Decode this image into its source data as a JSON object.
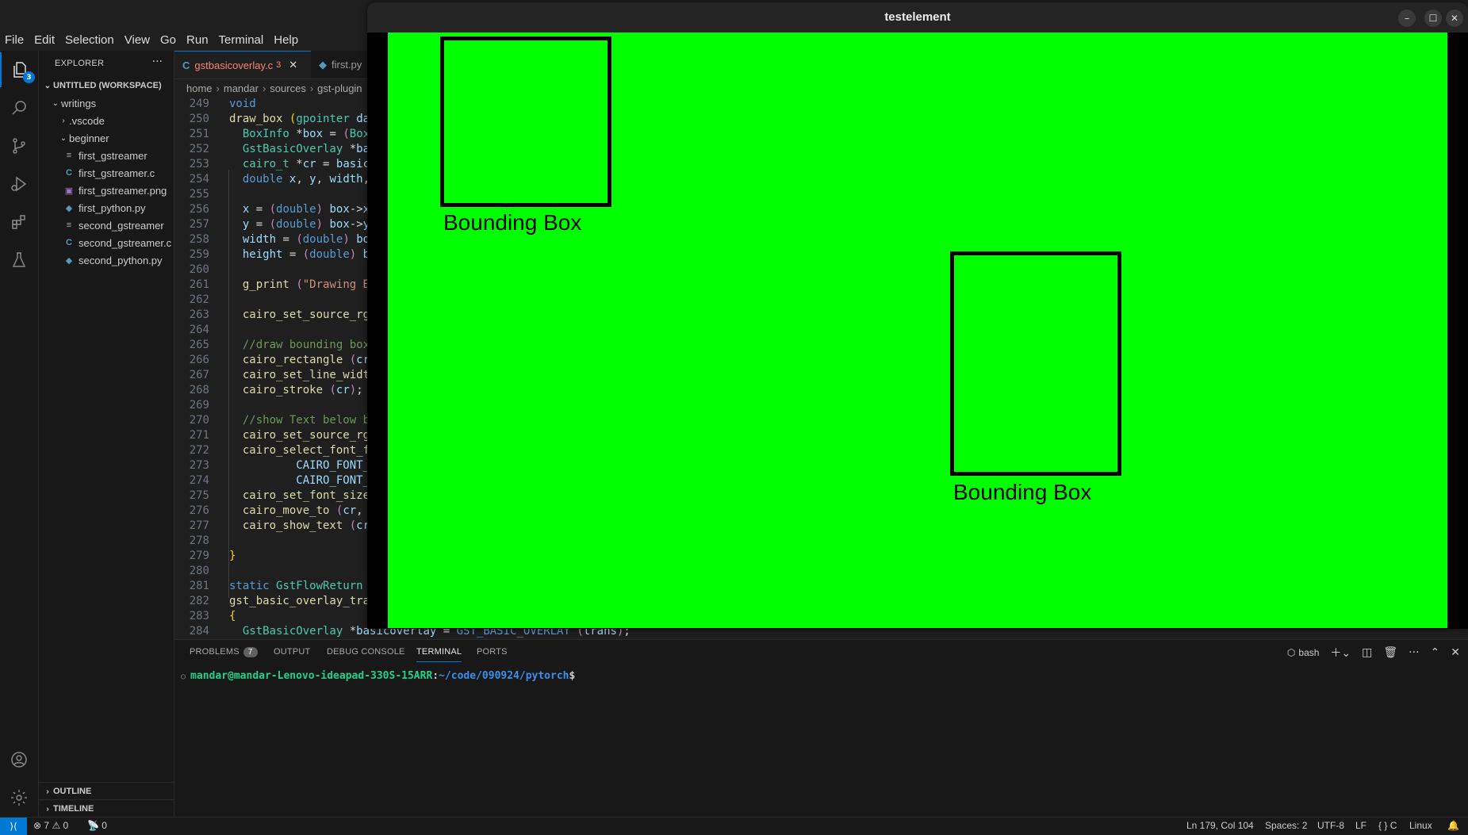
{
  "menu": [
    "File",
    "Edit",
    "Selection",
    "View",
    "Go",
    "Run",
    "Terminal",
    "Help"
  ],
  "activity": {
    "explorer_badge": "3"
  },
  "sidebar": {
    "title": "EXPLORER",
    "more": "···",
    "workspace": "UNTITLED (WORKSPACE)",
    "items": [
      {
        "label": "writings",
        "icon": "chevron-down",
        "depth": 1
      },
      {
        "label": ".vscode",
        "icon": "chevron-right",
        "depth": 2
      },
      {
        "label": "beginner",
        "icon": "chevron-down",
        "depth": 2
      },
      {
        "label": "first_gstreamer",
        "icon": "text-file",
        "depth": 3
      },
      {
        "label": "first_gstreamer.c",
        "icon": "c-file",
        "depth": 3
      },
      {
        "label": "first_gstreamer.png",
        "icon": "image-file",
        "depth": 3
      },
      {
        "label": "first_python.py",
        "icon": "python-file",
        "depth": 3
      },
      {
        "label": "second_gstreamer",
        "icon": "text-file",
        "depth": 3
      },
      {
        "label": "second_gstreamer.c",
        "icon": "c-file",
        "depth": 3
      },
      {
        "label": "second_python.py",
        "icon": "python-file",
        "depth": 3
      }
    ],
    "outline": "OUTLINE",
    "timeline": "TIMELINE"
  },
  "tabs": [
    {
      "label": "gstbasicoverlay.c",
      "problems": "3",
      "icon": "C"
    },
    {
      "label": "first.py",
      "icon": "python"
    }
  ],
  "breadcrumb": [
    "home",
    "mandar",
    "sources",
    "gst-plugin"
  ],
  "code": [
    {
      "n": "249",
      "html": "<span class='kw'>void</span>"
    },
    {
      "n": "250",
      "html": "<span class='fn'>draw_box</span> <span class='br'>(</span><span class='ty'>gpointer</span> <span class='var'>da</span>"
    },
    {
      "n": "251",
      "html": "  <span class='ty'>BoxInfo</span> *<span class='var'>box</span> = <span class='par'>(</span><span class='ty'>Box</span>"
    },
    {
      "n": "252",
      "html": "  <span class='ty'>GstBasicOverlay</span> *<span class='var'>ba</span>"
    },
    {
      "n": "253",
      "html": "  <span class='ty'>cairo_t</span> *<span class='var'>cr</span> = <span class='var'>basic</span>"
    },
    {
      "n": "254",
      "html": "  <span class='kw'>double</span> <span class='var'>x</span>, <span class='var'>y</span>, <span class='var'>width</span>,"
    },
    {
      "n": "255",
      "html": ""
    },
    {
      "n": "256",
      "html": "  <span class='var'>x</span> = <span class='par'>(</span><span class='kw'>double</span><span class='par'>)</span> <span class='var'>box</span>-&gt;<span class='var'>x</span>"
    },
    {
      "n": "257",
      "html": "  <span class='var'>y</span> = <span class='par'>(</span><span class='kw'>double</span><span class='par'>)</span> <span class='var'>box</span>-&gt;<span class='var'>y</span>"
    },
    {
      "n": "258",
      "html": "  <span class='var'>width</span> = <span class='par'>(</span><span class='kw'>double</span><span class='par'>)</span> <span class='var'>bo</span>"
    },
    {
      "n": "259",
      "html": "  <span class='var'>height</span> = <span class='par'>(</span><span class='kw'>double</span><span class='par'>)</span> <span class='var'>b</span>"
    },
    {
      "n": "260",
      "html": ""
    },
    {
      "n": "261",
      "html": "  <span class='fn'>g_print</span> <span class='par'>(</span><span class='str'>\"Drawing B</span>"
    },
    {
      "n": "262",
      "html": ""
    },
    {
      "n": "263",
      "html": "  <span class='fn'>cairo_set_source_rg</span>"
    },
    {
      "n": "264",
      "html": ""
    },
    {
      "n": "265",
      "html": "  <span class='cm'>//draw bounding box</span>"
    },
    {
      "n": "266",
      "html": "  <span class='fn'>cairo_rectangle</span> <span class='par'>(</span><span class='var'>cr</span>"
    },
    {
      "n": "267",
      "html": "  <span class='fn'>cairo_set_line_widt</span>"
    },
    {
      "n": "268",
      "html": "  <span class='fn'>cairo_stroke</span> <span class='par'>(</span><span class='var'>cr</span><span class='par'>)</span>;"
    },
    {
      "n": "269",
      "html": ""
    },
    {
      "n": "270",
      "html": "  <span class='cm'>//show Text below b</span>"
    },
    {
      "n": "271",
      "html": "  <span class='fn'>cairo_set_source_rg</span>"
    },
    {
      "n": "272",
      "html": "  <span class='fn'>cairo_select_font_f</span>"
    },
    {
      "n": "273",
      "html": "          <span class='var'>CAIRO_FONT_</span>"
    },
    {
      "n": "274",
      "html": "          <span class='var'>CAIRO_FONT_</span>"
    },
    {
      "n": "275",
      "html": "  <span class='fn'>cairo_set_font_size</span>"
    },
    {
      "n": "276",
      "html": "  <span class='fn'>cairo_move_to</span> <span class='par'>(</span><span class='var'>cr</span>,"
    },
    {
      "n": "277",
      "html": "  <span class='fn'>cairo_show_text</span> <span class='par'>(</span><span class='var'>cr</span>"
    },
    {
      "n": "278",
      "html": ""
    },
    {
      "n": "279",
      "html": "<span class='br'>}</span>"
    },
    {
      "n": "280",
      "html": ""
    },
    {
      "n": "281",
      "html": "<span class='kw'>static</span> <span class='ty'>GstFlowReturn</span>"
    },
    {
      "n": "282",
      "html": "<span class='fn'>gst_basic_overlay_tra</span>"
    },
    {
      "n": "283",
      "html": "<span class='br'>{</span>"
    },
    {
      "n": "284",
      "html": "  <span class='ty'>GstBasicOverlay</span> *<span class='var'>basicoverlay</span> = <span class='kw'>GST_BASIC_OVERLAY</span> <span class='par'>(</span><span class='var'>trans</span><span class='par'>)</span>;"
    }
  ],
  "panel": {
    "tabs": [
      "PROBLEMS",
      "OUTPUT",
      "DEBUG CONSOLE",
      "TERMINAL",
      "PORTS"
    ],
    "problems_count": "7",
    "active": "TERMINAL",
    "shell": "bash",
    "prompt_user": "mandar@mandar-Lenovo-ideapad-330S-15ARR",
    "prompt_path": "~/code/090924/pytorch",
    "prompt_sign": "$"
  },
  "status": {
    "errors": "7",
    "warnings": "0",
    "ports": "0",
    "position": "Ln 179, Col 104",
    "spaces": "Spaces: 2",
    "encoding": "UTF-8",
    "eol": "LF",
    "language": "C",
    "os": "Linux"
  },
  "window": {
    "title": "testelement",
    "canvas_color": "#00ff00",
    "boxes": [
      {
        "label": "Bounding Box"
      },
      {
        "label": "Bounding Box"
      }
    ]
  },
  "colors": {
    "accent": "#0078d4",
    "error_tab": "#f48771",
    "canvas": "#00ff00"
  }
}
